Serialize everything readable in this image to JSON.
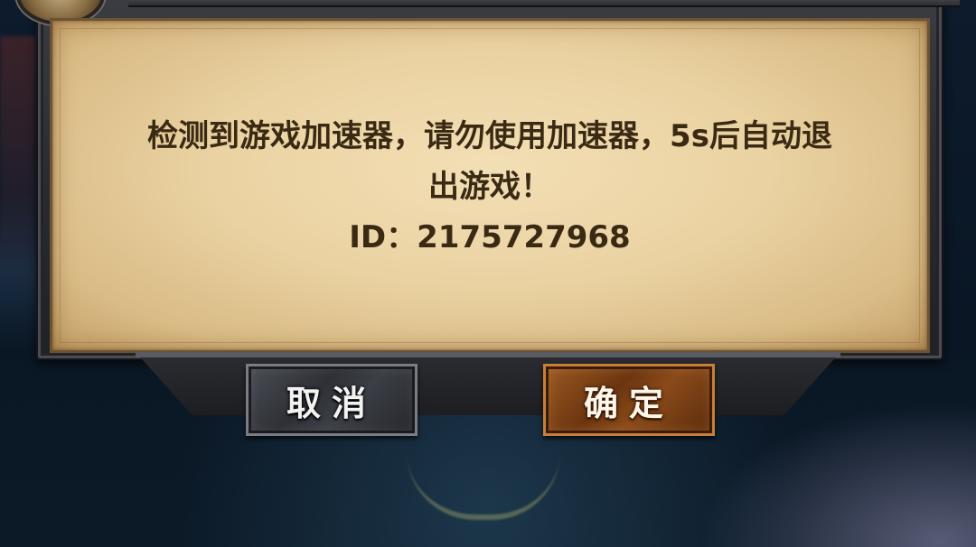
{
  "dialog": {
    "message_line1": "检测到游戏加速器，请勿使用加速器，5s后自动退",
    "message_line2": "出游戏！",
    "id_text": "ID：2175727968"
  },
  "buttons": {
    "cancel_label": "取消",
    "confirm_label": "确定"
  },
  "colors": {
    "parchment": "#ead2a2",
    "text": "#3a2a14",
    "cancel_button": "#3c3f46",
    "confirm_button": "#8a4a1a"
  }
}
